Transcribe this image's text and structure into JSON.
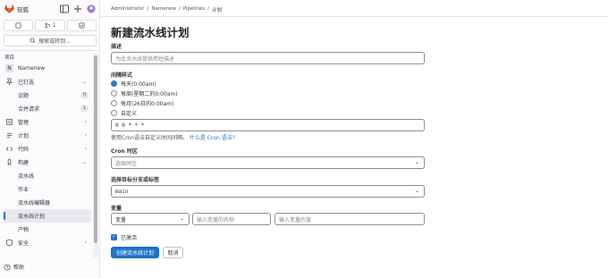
{
  "app": {
    "brand": "轻狐"
  },
  "sidebar": {
    "top_pills": [
      {
        "icon": "issues-icon",
        "count": ""
      },
      {
        "icon": "merge-request-icon",
        "count": "1"
      },
      {
        "icon": "todo-icon",
        "count": ""
      }
    ],
    "search_label": "搜索或转到...",
    "section_label": "项目",
    "items": [
      {
        "label": "Namenew",
        "type": "project",
        "letter": "N"
      },
      {
        "label": "已钉选",
        "type": "group",
        "icon": "pin-icon",
        "chevron": "⌄"
      },
      {
        "label": "议题",
        "type": "sub",
        "badge": "0"
      },
      {
        "label": "合并请求",
        "type": "sub",
        "badge": "1"
      },
      {
        "label": "管理",
        "type": "group",
        "icon": "manage-icon",
        "chevron": "›"
      },
      {
        "label": "计划",
        "type": "group",
        "icon": "plan-icon",
        "chevron": "›"
      },
      {
        "label": "代码",
        "type": "group",
        "icon": "code-icon",
        "chevron": "›"
      },
      {
        "label": "构建",
        "type": "group",
        "icon": "rocket-icon",
        "chevron": "⌄"
      },
      {
        "label": "流水线",
        "type": "sub"
      },
      {
        "label": "作业",
        "type": "sub"
      },
      {
        "label": "流水线编辑器",
        "type": "sub"
      },
      {
        "label": "流水线计划",
        "type": "sub",
        "active": true
      },
      {
        "label": "产物",
        "type": "sub"
      },
      {
        "label": "安全",
        "type": "group",
        "icon": "shield-icon",
        "chevron": "›"
      }
    ],
    "help_label": "帮助"
  },
  "breadcrumb": [
    "Administrator",
    "Namenew",
    "Pipelines",
    "计划"
  ],
  "page": {
    "title": "新建流水线计划",
    "description_label": "描述",
    "description_placeholder": "为此流水线提供简短描述",
    "interval_label": "间隔样式",
    "interval_options": [
      {
        "label": "每天(0:00am)",
        "checked": true
      },
      {
        "label": "每周(星期二的0:00am)",
        "checked": false
      },
      {
        "label": "每月(26日的0:00am)",
        "checked": false
      },
      {
        "label": "自定义",
        "checked": false
      }
    ],
    "cron_value": "0 0 * * *",
    "cron_help_text": "使用Cron语法自定义时间间隔。",
    "cron_help_link": "什么是 Cron 语法?",
    "timezone_label": "Cron 时区",
    "timezone_placeholder": "选择时区",
    "branch_label": "选择目标分支或标签",
    "branch_value": "main",
    "variables_label": "变量",
    "variable_type": "变量",
    "variable_key_placeholder": "输入变量的名称",
    "variable_value_placeholder": "输入变量的值",
    "activated_label": "已激活",
    "activated": true,
    "submit_label": "创建流水线计划",
    "cancel_label": "取消"
  },
  "colors": {
    "accent": "#1f75cb",
    "logo": "#e24329"
  }
}
